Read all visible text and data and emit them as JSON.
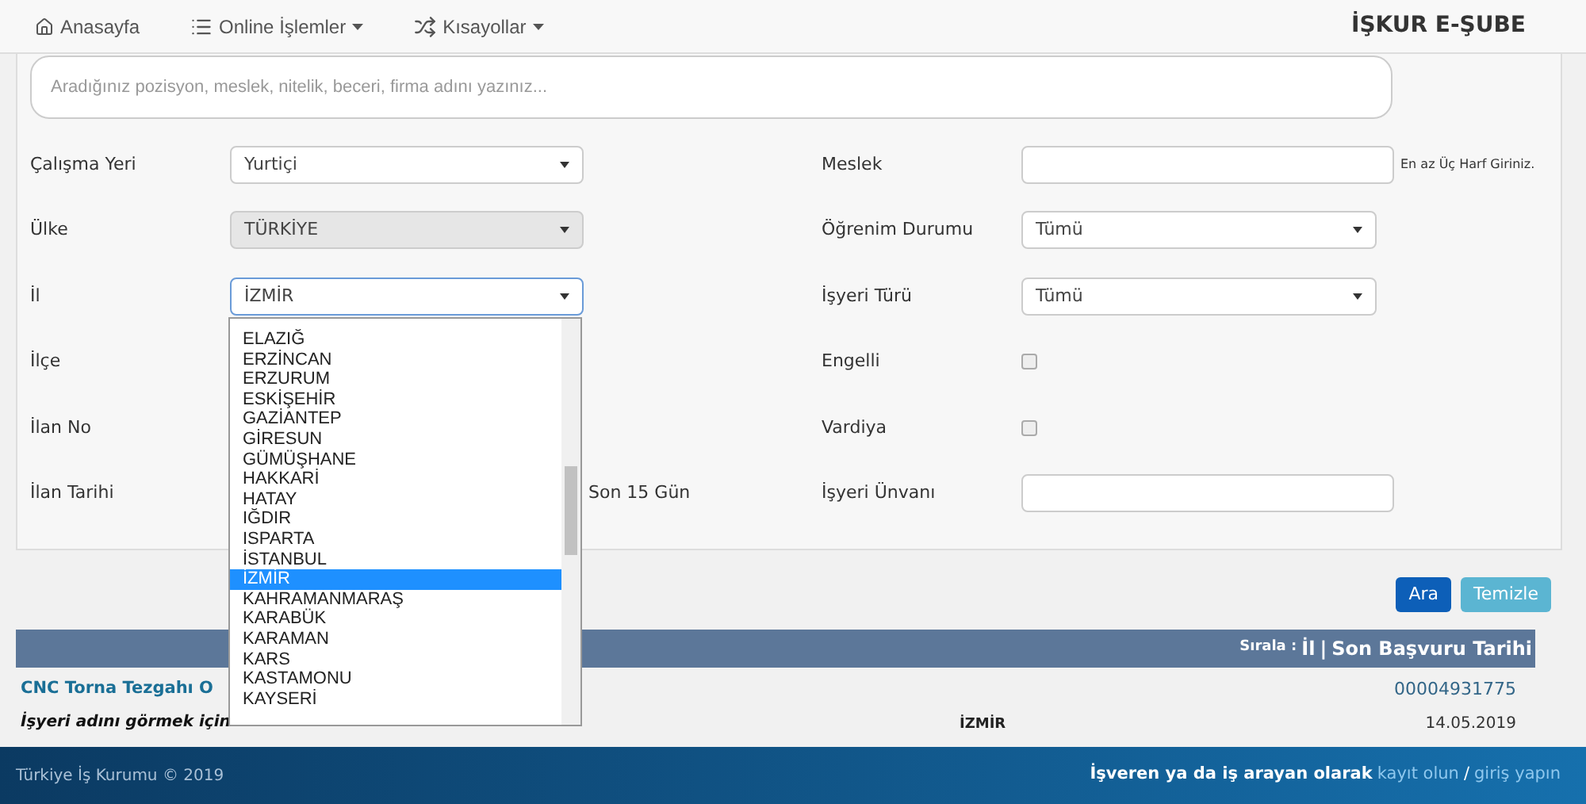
{
  "navbar": {
    "items": [
      {
        "label": "Anasayfa",
        "caret": false
      },
      {
        "label": "Online İşlemler",
        "caret": true
      },
      {
        "label": "Kısayollar",
        "caret": true
      }
    ],
    "brand": "İŞKUR E-ŞUBE"
  },
  "search": {
    "placeholder": "Aradığınız pozisyon, meslek, nitelik, beceri, firma adını yazınız..."
  },
  "left_fields": [
    {
      "label": "Çalışma Yeri",
      "kind": "select",
      "value": "Yurtiçi",
      "disabled": false,
      "focused": false
    },
    {
      "label": "Ülke",
      "kind": "select",
      "value": "TÜRKİYE",
      "disabled": true,
      "focused": false
    },
    {
      "label": "İl",
      "kind": "select",
      "value": "İZMİR",
      "disabled": false,
      "focused": true
    },
    {
      "label": "İlçe",
      "kind": "covered"
    },
    {
      "label": "İlan No",
      "kind": "covered"
    },
    {
      "label": "İlan Tarihi",
      "kind": "trailing",
      "text": "Son 15 Gün"
    }
  ],
  "right_fields": [
    {
      "label": "Meslek",
      "kind": "text",
      "hint": "En az Üç Harf Giriniz."
    },
    {
      "label": "Öğrenim Durumu",
      "kind": "select",
      "value": "Tümü",
      "disabled": false,
      "focused": false
    },
    {
      "label": "İşyeri Türü",
      "kind": "select",
      "value": "Tümü",
      "disabled": false,
      "focused": false
    },
    {
      "label": "Engelli",
      "kind": "checkbox",
      "checked": false
    },
    {
      "label": "Vardiya",
      "kind": "checkbox",
      "checked": false
    },
    {
      "label": "İşyeri Ünvanı",
      "kind": "text"
    }
  ],
  "dropdown": {
    "options": [
      {
        "label": "ELAZIĞ",
        "selected": false
      },
      {
        "label": "ERZİNCAN",
        "selected": false
      },
      {
        "label": "ERZURUM",
        "selected": false
      },
      {
        "label": "ESKİŞEHİR",
        "selected": false
      },
      {
        "label": "GAZİANTEP",
        "selected": false
      },
      {
        "label": "GİRESUN",
        "selected": false
      },
      {
        "label": "GÜMÜŞHANE",
        "selected": false
      },
      {
        "label": "HAKKARİ",
        "selected": false
      },
      {
        "label": "HATAY",
        "selected": false
      },
      {
        "label": "IĞDIR",
        "selected": false
      },
      {
        "label": "ISPARTA",
        "selected": false
      },
      {
        "label": "İSTANBUL",
        "selected": false
      },
      {
        "label": "İZMİR",
        "selected": true
      },
      {
        "label": "KAHRAMANMARAŞ",
        "selected": false
      },
      {
        "label": "KARABÜK",
        "selected": false
      },
      {
        "label": "KARAMAN",
        "selected": false
      },
      {
        "label": "KARS",
        "selected": false
      },
      {
        "label": "KASTAMONU",
        "selected": false
      },
      {
        "label": "KAYSERİ",
        "selected": false
      }
    ]
  },
  "buttons": [
    {
      "label": "Ara",
      "kind": "primary"
    },
    {
      "label": "Temizle",
      "kind": "info"
    }
  ],
  "results": {
    "sort_label": "Sırala :",
    "sort_links": [
      "İl",
      "Son Başvuru Tarihi"
    ],
    "separator": "|",
    "rows": [
      {
        "title": "CNC Torna Tezgahı O",
        "note": "İşyeri adını görmek için",
        "city": "İZMİR",
        "number": "00004931775",
        "date": "14.05.2019"
      }
    ]
  },
  "footer": {
    "copyright": "Türkiye İş Kurumu © 2019",
    "prompt": "İşveren ya da iş arayan olarak",
    "links": [
      "kayıt olun",
      "giriş yapın"
    ],
    "separator": "/"
  }
}
